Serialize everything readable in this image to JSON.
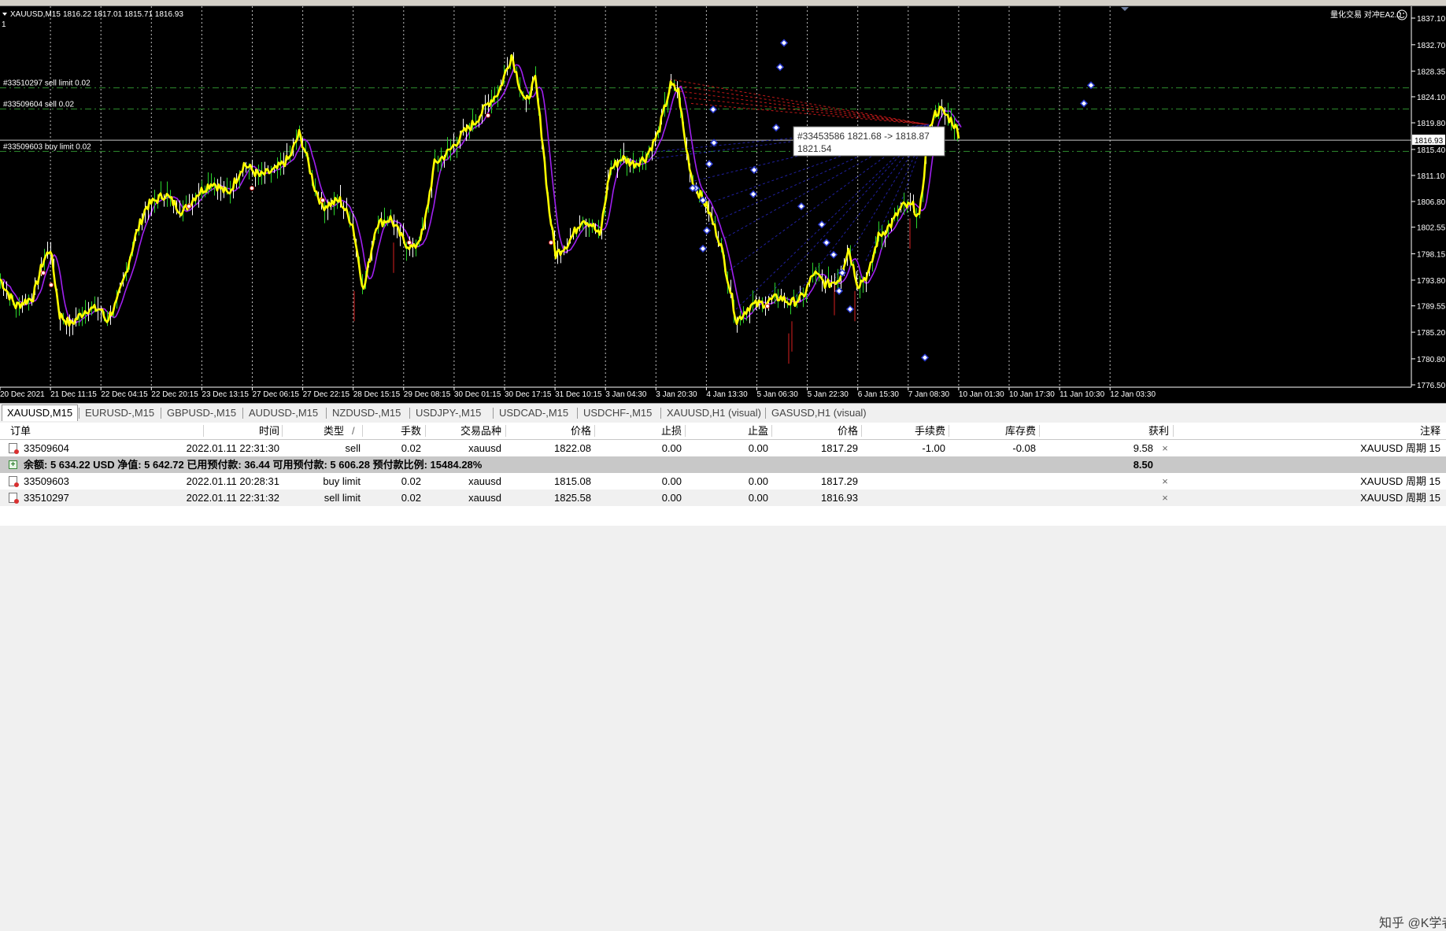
{
  "chart": {
    "title": "XAUUSD,M15",
    "ohlc": "1816.22 1817.01 1815.71 1816.93",
    "sub_label": "1",
    "ea_label": "量化交易 对冲EA2.0",
    "current_price": "1816.93",
    "price_ticks": [
      "1837.10",
      "1832.70",
      "1828.35",
      "1824.10",
      "1819.80",
      "1815.40",
      "1811.10",
      "1806.80",
      "1802.55",
      "1798.15",
      "1793.80",
      "1789.55",
      "1785.20",
      "1780.80",
      "1776.50"
    ],
    "time_ticks": [
      "20 Dec 2021",
      "21 Dec 11:15",
      "22 Dec 04:15",
      "22 Dec 20:15",
      "23 Dec 13:15",
      "27 Dec 06:15",
      "27 Dec 22:15",
      "28 Dec 15:15",
      "29 Dec 08:15",
      "30 Dec 01:15",
      "30 Dec 17:15",
      "31 Dec 10:15",
      "3 Jan 04:30",
      "3 Jan 20:30",
      "4 Jan 13:30",
      "5 Jan 06:30",
      "5 Jan 22:30",
      "6 Jan 15:30",
      "7 Jan 08:30",
      "10 Jan 01:30",
      "10 Jan 17:30",
      "11 Jan 10:30",
      "12 Jan 03:30"
    ],
    "order_lines": [
      {
        "label": "#33510297 sell limit 0.02",
        "price": 1825.58
      },
      {
        "label": "#33509604 sell 0.02",
        "price": 1822.08
      },
      {
        "label": "#33509603 buy limit 0.02",
        "price": 1815.08
      }
    ],
    "tooltip_line1": "#33453586 1821.68 -> 1818.87",
    "tooltip_line2": "1821.54",
    "colors": {
      "background": "#000000",
      "price_line": "#ffff00",
      "ma": "#a020f0",
      "grid": "#ffffff",
      "order_line": "#2e8b2e",
      "sell_trade": "#c01818",
      "buy_trade": "#2020a0"
    }
  },
  "chart_tabs": [
    "XAUUSD,M15",
    "EURUSD-,M15",
    "GBPUSD-,M15",
    "AUDUSD-,M15",
    "NZDUSD-,M15",
    "USDJPY-,M15",
    "USDCAD-,M15",
    "USDCHF-,M15",
    "XAUUSD,H1 (visual)",
    "GASUSD,H1 (visual)"
  ],
  "terminal": {
    "headers": {
      "order": "订单",
      "time": "时间",
      "type": "类型",
      "sort": "/",
      "lots": "手数",
      "symbol": "交易品种",
      "price": "价格",
      "sl": "止损",
      "tp": "止盈",
      "price2": "价格",
      "commission": "手续费",
      "swap": "库存费",
      "profit": "获利",
      "comment": "注释"
    },
    "rows": [
      {
        "order": "33509604",
        "time": "2022.01.11 22:31:30",
        "type": "sell",
        "lots": "0.02",
        "symbol": "xauusd",
        "price": "1822.08",
        "sl": "0.00",
        "tp": "0.00",
        "price2": "1817.29",
        "commission": "-1.00",
        "swap": "-0.08",
        "profit": "9.58",
        "comment": "XAUUSD 周期 15"
      },
      {
        "order": "33509603",
        "time": "2022.01.11 20:28:31",
        "type": "buy limit",
        "lots": "0.02",
        "symbol": "xauusd",
        "price": "1815.08",
        "sl": "0.00",
        "tp": "0.00",
        "price2": "1817.29",
        "commission": "",
        "swap": "",
        "profit": "",
        "comment": "XAUUSD 周期 15"
      },
      {
        "order": "33510297",
        "time": "2022.01.11 22:31:32",
        "type": "sell limit",
        "lots": "0.02",
        "symbol": "xauusd",
        "price": "1825.58",
        "sl": "0.00",
        "tp": "0.00",
        "price2": "1816.93",
        "commission": "",
        "swap": "",
        "profit": "",
        "comment": "XAUUSD 周期 15"
      }
    ],
    "balance_text": "余额: 5 634.22 USD  净值: 5 642.72  已用预付款: 36.44  可用预付款: 5 606.28  预付款比例: 15484.28%",
    "balance_profit": "8.50",
    "close_symbol": "×"
  },
  "watermark": "知乎 @K学者"
}
